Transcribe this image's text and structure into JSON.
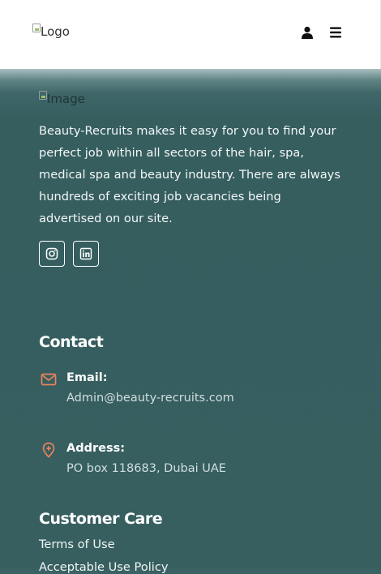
{
  "header": {
    "logo_alt": "Logo"
  },
  "footer": {
    "about": {
      "image_alt": "Image",
      "text": "Beauty-Recruits makes it easy for you to find your perfect job within all sectors of the hair, spa, medical spa and beauty industry. There are always hundreds of exciting job vacancies being advertised on our site."
    },
    "contact": {
      "heading": "Contact",
      "email_label": "Email:",
      "email_value": "Admin@beauty-recruits.com",
      "address_label": "Address:",
      "address_value": "PO box 118683, Dubai UAE"
    },
    "customer_care": {
      "heading": "Customer Care",
      "links": [
        "Terms of Use",
        "Acceptable Use Policy"
      ]
    }
  },
  "colors": {
    "footer_bg": "#375f60",
    "accent": "#e9835a",
    "header_bg": "#ffffff"
  },
  "icons": [
    "user-icon",
    "menu-icon",
    "instagram-icon",
    "linkedin-icon",
    "mail-icon",
    "location-icon"
  ]
}
